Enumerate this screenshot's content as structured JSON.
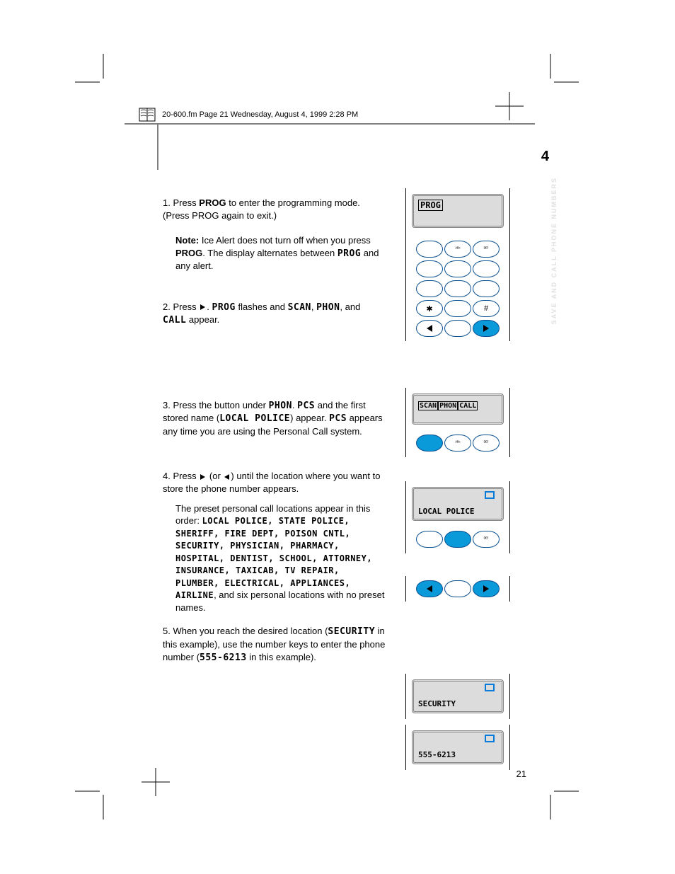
{
  "page": {
    "number": "21",
    "footer": "20-600.fm  Page 21  Wednesday, August 4, 1999  2:28 PM",
    "section_number": "4",
    "section_header_white": "SAVE AND CALL PHONE NUMBERS"
  },
  "instructions": {
    "para1_prefix": "1. Press ",
    "prog_label": "PROG",
    "para1_suffix": " to enter the programming mode. (Press PROG again to exit.)",
    "para2": "Note: Ice Alert does not turn off when you press PROG. The display alternates between PROG and any alert.",
    "para3_prefix": "2. Press ",
    "para3_suffix": ". PROG flashes and SCAN, PHON, and CALL appear.",
    "para4_prefix": "3. Press the button under PHON. PCS and the first stored name (",
    "local_police": "LOCAL POLICE",
    "para4_suffix": ") appear. PCS appears any time you are using the Personal Call system.",
    "para5_prefix": "4. Press ",
    "para5_mid": " (or ",
    "para5_suffix": ") until the location where you want to store the phone number appears.",
    "para6_prefix": "The preset personal call locations appear in this order: ",
    "preset_list": "LOCAL POLICE, STATE POLICE, SHERIFF, FIRE DEPT, POISON CNTL, SECURITY, PHYSICIAN, PHARMACY, HOSPITAL, DENTIST, SCHOOL, ATTORNEY, INSURANCE, TAXICAB, TV REPAIR, PLUMBER, ELECTRICAL, APPLIANCES, AIRLINE",
    "para6_suffix": ", and six personal locations with no preset names.",
    "para7_prefix": "5. When you reach the desired location (",
    "security": "SECURITY",
    "para7_mid": " in this example), use the number keys to enter the phone number (",
    "phone_number": "555-6213",
    "para7_suffix": " in this example)."
  },
  "panels": {
    "p1": {
      "display": "PROG"
    },
    "p2": {
      "tab1": "SCAN",
      "tab2": "PHON",
      "tab3": "CALL"
    },
    "p3": {
      "display": "LOCAL POLICE"
    },
    "p4": {
      "display": "SECURITY"
    },
    "p5": {
      "display": "555-6213"
    }
  },
  "keys": {
    "star": "✱",
    "hash": "#"
  }
}
